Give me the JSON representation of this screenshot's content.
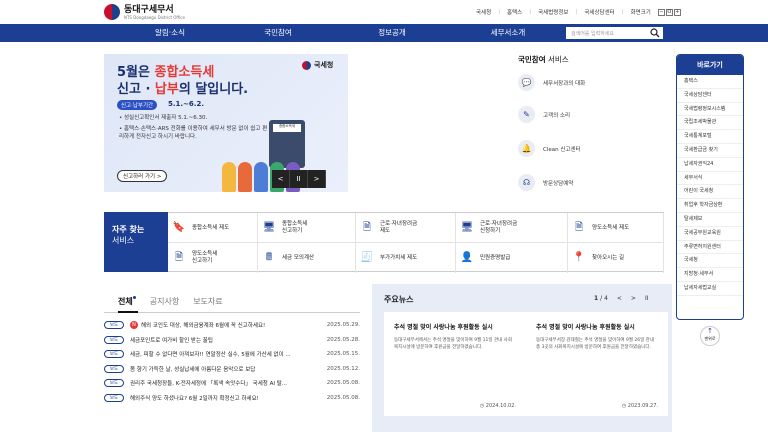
{
  "header": {
    "org_name": "동대구세무서",
    "org_sub": "NTS Dongdaegu District Office",
    "util": [
      "국세청",
      "홈택스",
      "국세법령정보",
      "국세상담센터"
    ],
    "zoom_label": "화면크기",
    "zoom_buttons": [
      "−",
      "O",
      "+"
    ]
  },
  "nav": [
    "알림·소식",
    "국민참여",
    "정보공개",
    "세무서소개"
  ],
  "search": {
    "placeholder": "검색어를 입력하세요"
  },
  "banner": {
    "line1a": "5월은 ",
    "line1b": "종합소득세",
    "line2a": "신고 · ",
    "line2b": "납부",
    "line2c": "의 달입니다.",
    "pill": "신고·납부기간",
    "date": "5.1.~6.2.",
    "line3": "• 성실신고확인서 제출자  5.1.~6.30.",
    "line4": "• 홈택스·손택스·ARS 전화를 이용하여 세무서 방문 없이 쉽고 편리하게 전자신고 하시기 바랍니다.",
    "button": "신고하러 가기 >",
    "brand": "국세청",
    "calc_screen": "종합소득세",
    "controls": [
      "<",
      "II",
      ">"
    ]
  },
  "civil": {
    "title": "국민참여",
    "title_suffix": " 서비스",
    "items": [
      {
        "label": "세무서장과의 대화",
        "icon": "chat-icon"
      },
      {
        "label": "고객의 소리",
        "icon": "pen-icon"
      },
      {
        "label": "Clean 신고센터",
        "icon": "bell-icon"
      },
      {
        "label": "방문상담예약",
        "icon": "headset-icon"
      }
    ]
  },
  "quick": {
    "title": "바로가기",
    "items": [
      "홈택스",
      "국세상담센터",
      "국세법령정보시스템",
      "국립조세박물관",
      "국세통계포털",
      "국세환급금 찾기",
      "납세자권익24",
      "세무서식",
      "어린이 국세청",
      "취업후 학자금상환",
      "탈세제보",
      "국세공무원교육원",
      "주류면허지원센터",
      "국세청",
      "지방청·세무서",
      "납세자세법교실"
    ]
  },
  "to_top": "맨위로",
  "frequent": {
    "title1": "자주 찾는",
    "title2": "서비스",
    "items": [
      {
        "label": "종합소득세 제도",
        "icon": "bookmark-icon"
      },
      {
        "label": "종합소득세\n신고하기",
        "icon": "computer-icon"
      },
      {
        "label": "근로·자녀장려금\n제도",
        "icon": "doc-icon"
      },
      {
        "label": "근로·자녀장려금\n신청하기",
        "icon": "computer-icon"
      },
      {
        "label": "양도소득세 제도",
        "icon": "doc-icon"
      },
      {
        "label": "양도소득세\n신고하기",
        "icon": "doc-icon"
      },
      {
        "label": "세금 모의계산",
        "icon": "calc-icon"
      },
      {
        "label": "부가가치세 제도",
        "icon": "vat-icon"
      },
      {
        "label": "민원증명발급",
        "icon": "person-icon"
      },
      {
        "label": "찾아오시는 길",
        "icon": "map-pin-icon"
      }
    ]
  },
  "tabs": [
    "전체",
    "공지사항",
    "보도자료"
  ],
  "news": [
    {
      "badge": "보도",
      "new": "N",
      "title": "해외 코인도 대상, 해외금융계좌 6월에 꼭 신고하세요!",
      "date": "2025.05.29."
    },
    {
      "badge": "보도",
      "title": "세금포인트로 여가비 할인 받는 꿀팁",
      "date": "2025.05.28."
    },
    {
      "badge": "보도",
      "title": "세금, 피할 수 없다면 아껴보자!! 연말정산 실수, 5월에 가산세 없이 ...",
      "date": "2025.05.15."
    },
    {
      "badge": "보도",
      "title": "봄 향기 가득한 날, 성실납세에 아름다운 음악으로 보답",
      "date": "2025.05.12."
    },
    {
      "badge": "보도",
      "title": "권리주 국세청장들, K-전자세정에 「록색 속앗수다」 국세청 AI 탈...",
      "date": "2025.05.08."
    },
    {
      "badge": "보도",
      "title": "해외주식 양도 하셨나요? 6월 2일까지 확정신고 하세요!",
      "date": "2025.05.08."
    }
  ],
  "major": {
    "title": "주요뉴스",
    "page_current": "1",
    "page_sep": "/",
    "page_total": "4",
    "controls": [
      "<",
      ">",
      "II"
    ],
    "cards": [
      {
        "title": "추석 명절 맞이 사랑나눔 후원활동 실시",
        "body": "동대구세무서에서는 추석 명절을 맞이하여 9월 11일 관내 사회복지시설에 방문하여 후원금을 전달하였습니다.",
        "date": "2024.10.02."
      },
      {
        "title": "추석 명절 맞이 사랑나눔 후원활동 실시",
        "body": "동대구세무서장 김태철는 추석 명절을 맞이하여 9월 26일 관내 총 3곳의 사회복지시설에 방문하여 후원금을 전달하였습니다.",
        "date": "2023.09.27."
      }
    ]
  },
  "colors": {
    "primary": "#1c3f94",
    "accent": "#e53935"
  }
}
